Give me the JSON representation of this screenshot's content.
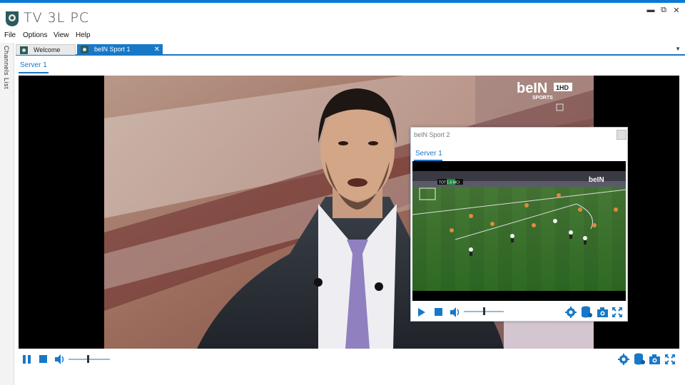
{
  "app": {
    "title": "TV 3L PC"
  },
  "window_controls": {
    "minimize": "▬",
    "restore": "⧉",
    "close": "✕"
  },
  "menu": {
    "items": [
      "File",
      "Options",
      "View",
      "Help"
    ]
  },
  "sidebar": {
    "label": "Channels List"
  },
  "tabs": [
    {
      "label": "Welcome",
      "active": false
    },
    {
      "label": "beIN Sport 1",
      "active": true,
      "close": "✕"
    }
  ],
  "tab_dropdown": "▼",
  "main": {
    "server_tab": "Server 1",
    "channel_logo": "beIN SPORTS",
    "hd_badge": "1HD"
  },
  "popup": {
    "title": "beIN Sport 2",
    "server_tab": "Server 1",
    "scoreboard": "TOT 1-0 MCI"
  },
  "colors": {
    "accent": "#1878c8",
    "topstripe": "#0a79d6"
  },
  "icons": {
    "play": "play-icon",
    "pause": "pause-icon",
    "stop": "stop-icon",
    "volume": "volume-icon",
    "settings": "gear-icon",
    "database": "database-icon",
    "camera": "camera-icon",
    "fullscreen": "fullscreen-icon"
  }
}
